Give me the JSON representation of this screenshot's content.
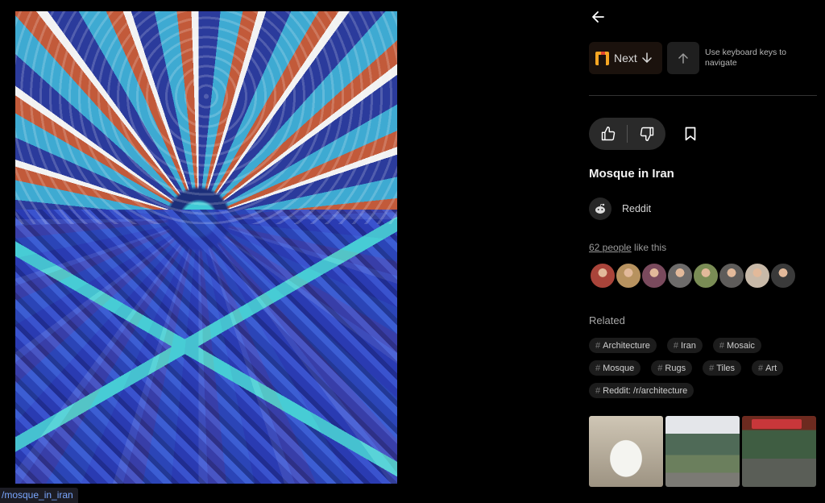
{
  "main_image": {
    "alt_icon": "image"
  },
  "status_bar": {
    "link": "/mosque_in_iran"
  },
  "nav": {
    "next_label": "Next",
    "hint": "Use keyboard keys to navigate"
  },
  "post": {
    "title": "Mosque in Iran",
    "source": "Reddit",
    "likes_count_text": "62 people",
    "likes_suffix": " like this"
  },
  "avatars": [
    {
      "color": "#a9443a"
    },
    {
      "color": "#b7925f"
    },
    {
      "color": "#7a4a5d"
    },
    {
      "color": "#6d6b6a"
    },
    {
      "color": "#7a8c55"
    },
    {
      "color": "#5e5c5a"
    },
    {
      "color": "#c8b9a8"
    },
    {
      "color": "#3a3a3a"
    }
  ],
  "related": {
    "title": "Related",
    "rows": [
      [
        "Architecture",
        "Iran",
        "Mosaic"
      ],
      [
        "Mosque",
        "Rugs",
        "Tiles",
        "Art"
      ],
      [
        "Reddit: /r/architecture"
      ]
    ]
  },
  "colors": {
    "background": "#000000",
    "accent_tag_bg": "#1c1c1c"
  }
}
